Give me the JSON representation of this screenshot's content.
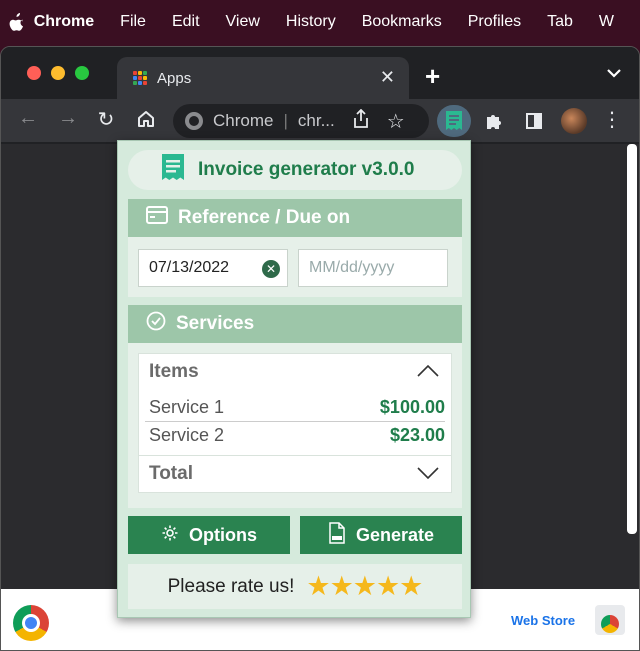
{
  "menubar": {
    "app": "Chrome",
    "items": [
      "File",
      "Edit",
      "View",
      "History",
      "Bookmarks",
      "Profiles",
      "Tab",
      "W"
    ]
  },
  "tab": {
    "title": "Apps"
  },
  "omnibox": {
    "label": "Chrome",
    "url": "chr..."
  },
  "bottom": {
    "webstore": "Web Store"
  },
  "popup": {
    "title": "Invoice generator v3.0.0",
    "reference_panel": {
      "title": "Reference / Due on",
      "ref_date": "07/13/2022",
      "due_placeholder": "MM/dd/yyyy"
    },
    "services_panel": {
      "title": "Services",
      "items_label": "Items",
      "lines": [
        {
          "name": "Service 1",
          "amount": "$100.00"
        },
        {
          "name": "Service 2",
          "amount": "$23.00"
        }
      ],
      "total_label": "Total"
    },
    "options_label": "Options",
    "generate_label": "Generate",
    "rate_text": "Please rate us!",
    "stars": "★★★★★"
  },
  "colors": {
    "accent": "#2a8350",
    "panel_header": "#9dc6a9",
    "popup_bg": "#d5eadc",
    "title_green": "#1f7d4b",
    "star": "#f5b81c"
  }
}
